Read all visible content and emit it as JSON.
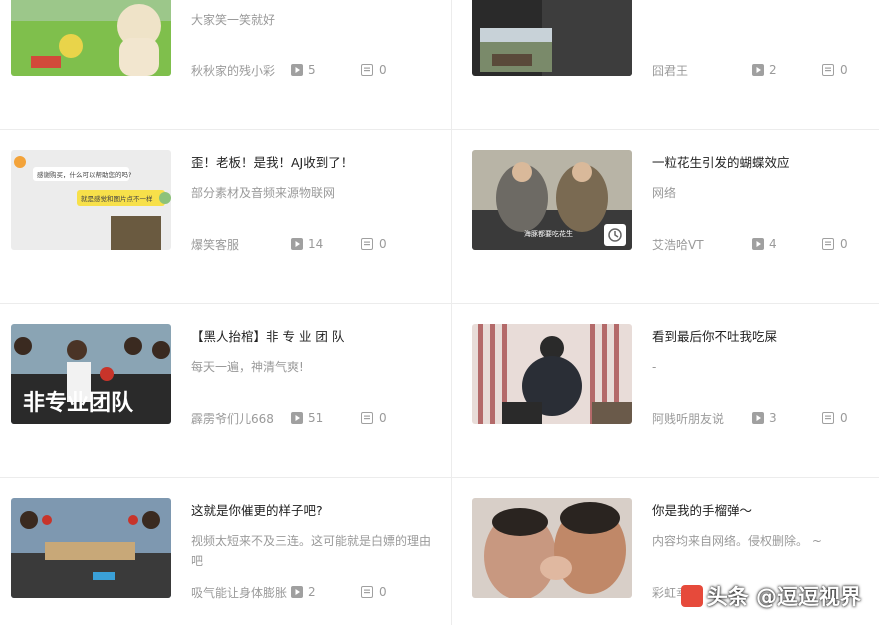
{
  "cards": [
    {
      "title": "",
      "desc": "大家笑一笑就好",
      "author": "秋秋家的残小彩",
      "plays": "5",
      "comments": "0"
    },
    {
      "title": "",
      "desc": "",
      "author": "囧君王",
      "plays": "2",
      "comments": "0"
    },
    {
      "title": "歪！老板！是我！AJ收到了！",
      "desc": "部分素材及音频来源物联网",
      "author": "爆笑客服",
      "plays": "14",
      "comments": "0",
      "thumb_text": [
        "感谢购买，什么可以帮助您的吗?",
        "就是感觉和图片点不一样"
      ]
    },
    {
      "title": "一粒花生引发的蝴蝶效应",
      "desc": "网络",
      "author": "艾浩哈VT",
      "plays": "4",
      "comments": "0",
      "thumb_text": [
        "海豚都要吃花生"
      ]
    },
    {
      "title": "【黑人抬棺】非 专 业 团 队",
      "desc": "每天一遍，神清气爽!",
      "author": "霹雳爷们儿668",
      "plays": "51",
      "comments": "0",
      "thumb_text": [
        "非专业团队"
      ]
    },
    {
      "title": "看到最后你不吐我吃屎",
      "desc": "-",
      "author": "阿贱听朋友说",
      "plays": "3",
      "comments": "0"
    },
    {
      "title": "这就是你催更的样子吧?",
      "desc": "视频太短来不及三连。这可能就是白嫖的理由吧",
      "author": "吸气能让身体膨胀",
      "plays": "2",
      "comments": "0"
    },
    {
      "title": "你是我的手榴弹～",
      "desc": "内容均来自网络。侵权删除。 ~",
      "author": "彩虹幸运",
      "plays": "",
      "comments": ""
    }
  ],
  "watermark": "头条 @逗逗视界"
}
